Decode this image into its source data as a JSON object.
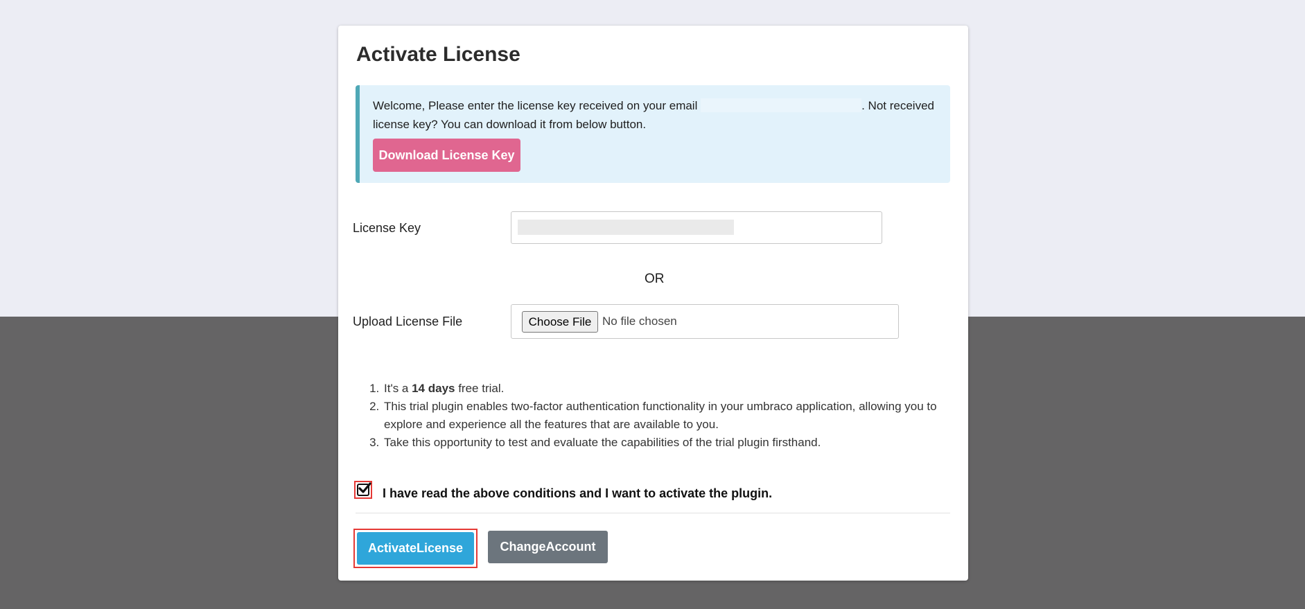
{
  "dialog": {
    "title": "Activate License",
    "alert": {
      "text_before_email": "Welcome, Please enter the license key received on your email ",
      "text_after_email": ". Not received license key? You can download it from below button.",
      "download_button": "Download License Key"
    },
    "license_key": {
      "label": "License Key",
      "value": ""
    },
    "or_separator": "OR",
    "upload": {
      "label": "Upload License File",
      "choose_button": "Choose File",
      "status": "No file chosen"
    },
    "conditions": {
      "item1_before": "It's a ",
      "item1_bold": "14 days",
      "item1_after": " free trial.",
      "item2": "This trial plugin enables two-factor authentication functionality in your umbraco application, allowing you to explore and experience all the features that are available to you.",
      "item3": "Take this opportunity to test and evaluate the capabilities of the trial plugin firsthand."
    },
    "agree": {
      "checked": true,
      "label": "I have read the above conditions and I want to activate the plugin."
    },
    "buttons": {
      "activate": "ActivateLicense",
      "change_account": "ChangeAccount"
    }
  },
  "colors": {
    "page_top": "#ecedf4",
    "page_bottom": "#656465",
    "alert_bg": "#e2f2fb",
    "alert_border": "#4fa8b6",
    "download_button": "#e06690",
    "activate_button": "#2fa6da",
    "change_button": "#6c757d",
    "highlight": "#e53935"
  },
  "icons": {
    "agree_check": "checkmark-icon"
  }
}
